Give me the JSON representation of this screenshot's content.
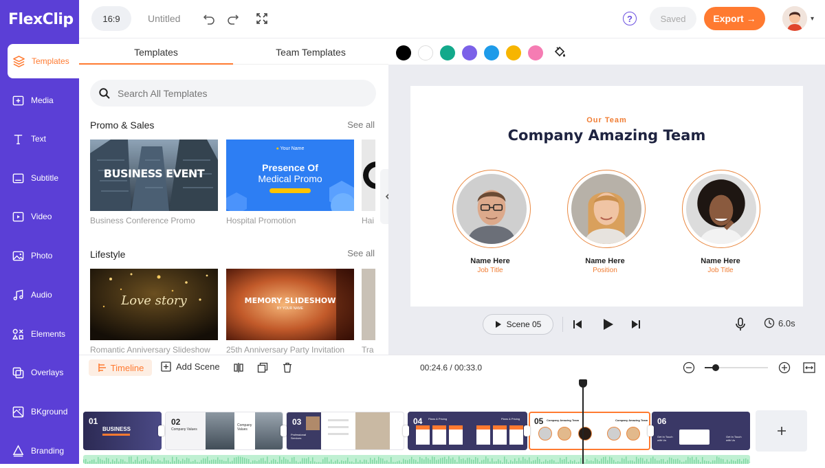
{
  "app": {
    "logo_text": "FlexClip"
  },
  "colors": {
    "brand_purple": "#5b3fd6",
    "accent_orange": "#ff7a30"
  },
  "sidebar": {
    "items": [
      {
        "label": "Templates",
        "icon": "layers-icon",
        "active": true
      },
      {
        "label": "Media",
        "icon": "media-add-icon"
      },
      {
        "label": "Text",
        "icon": "text-icon"
      },
      {
        "label": "Subtitle",
        "icon": "subtitle-icon"
      },
      {
        "label": "Video",
        "icon": "video-icon"
      },
      {
        "label": "Photo",
        "icon": "photo-icon"
      },
      {
        "label": "Audio",
        "icon": "music-note-icon"
      },
      {
        "label": "Elements",
        "icon": "elements-icon"
      },
      {
        "label": "Overlays",
        "icon": "overlays-icon"
      },
      {
        "label": "BKground",
        "icon": "background-icon"
      },
      {
        "label": "Branding",
        "icon": "branding-icon"
      }
    ]
  },
  "topbar": {
    "aspect_ratio": "16:9",
    "project_title": "Untitled",
    "saved_label": "Saved",
    "export_label": "Export →"
  },
  "panel": {
    "tabs": [
      {
        "label": "Templates",
        "active": true
      },
      {
        "label": "Team Templates",
        "active": false
      }
    ],
    "search_placeholder": "Search All Templates",
    "sections": [
      {
        "title": "Promo & Sales",
        "see_all": "See all",
        "items": [
          {
            "caption": "Business Conference Promo",
            "thumb_title": "BUSINESS EVENT"
          },
          {
            "caption": "Hospital Promotion",
            "thumb_title": "Presence Of",
            "thumb_subtitle": "Medical Promo",
            "thumb_top": "Your Name"
          },
          {
            "caption": "Hai"
          }
        ]
      },
      {
        "title": "Lifestyle",
        "see_all": "See all",
        "items": [
          {
            "caption": "Romantic Anniversary Slideshow",
            "thumb_title": "Love story"
          },
          {
            "caption": "25th Anniversary Party Invitation",
            "thumb_title": "MEMORY SLIDESHOW",
            "thumb_subtitle": "BY YOUR NAME"
          },
          {
            "caption": "Tra"
          }
        ]
      }
    ]
  },
  "colorbar": {
    "swatches": [
      "#000000",
      "#ffffff",
      "#13a98b",
      "#7b61e8",
      "#1e9be9",
      "#f7b500",
      "#f57cb3"
    ]
  },
  "slide": {
    "kicker": "Our Team",
    "title": "Company Amazing Team",
    "people": [
      {
        "name": "Name Here",
        "role": "Job Title"
      },
      {
        "name": "Name Here",
        "role": "Position"
      },
      {
        "name": "Name Here",
        "role": "Job Title"
      }
    ]
  },
  "player": {
    "scene_label": "Scene 05",
    "duration": "6.0s"
  },
  "timeline": {
    "label": "Timeline",
    "add_scene": "Add Scene",
    "time": "00:24.6 / 00:33.0",
    "scenes": [
      {
        "num": "01",
        "title": "BUSINESS"
      },
      {
        "num": "02",
        "title": "Company Values"
      },
      {
        "num": "03",
        "title": "Professional Services"
      },
      {
        "num": "04",
        "title": "Plans & Pricing"
      },
      {
        "num": "05",
        "title": "Company Amazing Team",
        "selected": true
      },
      {
        "num": "06",
        "title": "Get In Touch with Us"
      }
    ]
  }
}
